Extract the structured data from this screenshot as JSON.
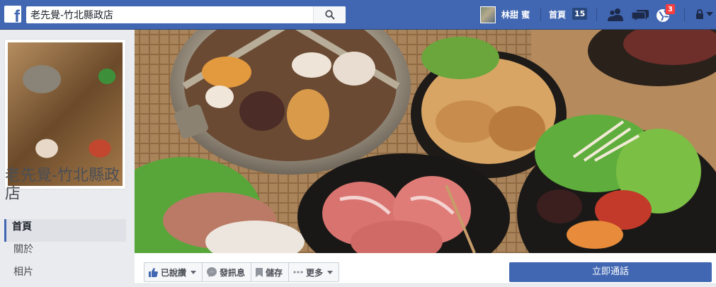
{
  "topbar": {
    "logo": "f",
    "search_value": "老先覺-竹北縣政店",
    "user_name": "林甜 蜜",
    "home_label": "首頁",
    "home_count": "15",
    "notification_count": "3",
    "brand_color": "#4267b2",
    "icons": [
      "facebook-logo-icon",
      "search-icon",
      "friend-requests-icon",
      "messages-icon",
      "notifications-icon",
      "privacy-lock-icon"
    ]
  },
  "page": {
    "name": "老先覺-竹北縣政店"
  },
  "sidebar": {
    "items": [
      {
        "label": "首頁",
        "active": true
      },
      {
        "label": "關於",
        "active": false
      },
      {
        "label": "相片",
        "active": false
      }
    ]
  },
  "actions": {
    "like_label": "已說讚",
    "message_label": "發訊息",
    "save_label": "儲存",
    "more_label": "更多",
    "call_label": "立即通話",
    "call_color": "#4267b2"
  }
}
